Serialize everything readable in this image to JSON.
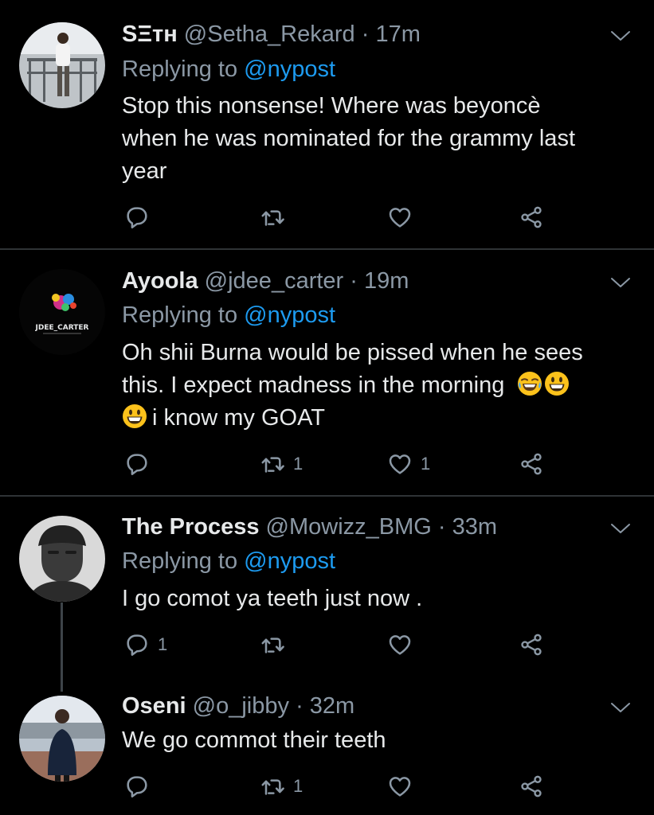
{
  "tweets": [
    {
      "name": "SΞтн",
      "handle": "@Setha_Rekard",
      "dot": "·",
      "time": "17m",
      "replying_label": "Replying to",
      "replying_to": "@nypost",
      "lines": [
        "Stop this nonsense! Where was beyoncè",
        "when he was nominated for the grammy last",
        "year"
      ],
      "reply_count": "",
      "retweet_count": "",
      "like_count": ""
    },
    {
      "name": "Ayoola",
      "handle": "@jdee_carter",
      "dot": "·",
      "time": "19m",
      "replying_label": "Replying to",
      "replying_to": "@nypost",
      "lines": [
        "Oh shii Burna would be pissed when he sees",
        "this. I expect madness in the morning",
        "i know my GOAT"
      ],
      "avatar_text": "JDEE_CARTER",
      "reply_count": "",
      "retweet_count": "1",
      "like_count": "1"
    },
    {
      "name": "The Process",
      "handle": "@Mowizz_BMG",
      "dot": "·",
      "time": "33m",
      "replying_label": "Replying to",
      "replying_to": "@nypost",
      "lines": [
        "I go comot ya teeth just now ."
      ],
      "reply_count": "1",
      "retweet_count": "",
      "like_count": ""
    },
    {
      "name": "Oseni",
      "handle": "@o_jibby",
      "dot": "·",
      "time": "32m",
      "lines": [
        "We go commot their teeth"
      ],
      "reply_count": "",
      "retweet_count": "1",
      "like_count": ""
    }
  ],
  "icons": {
    "reply": "reply-icon",
    "retweet": "retweet-icon",
    "like": "heart-icon",
    "share": "share-icon",
    "more": "chevron-down-icon",
    "emoji_laugh": "tears-of-joy-emoji",
    "emoji_smile": "grinning-face-emoji"
  },
  "colors": {
    "background": "#000000",
    "text": "#e7e9ea",
    "secondary": "#8b98a5",
    "link": "#1d9bf0",
    "divider": "#2f3336"
  }
}
